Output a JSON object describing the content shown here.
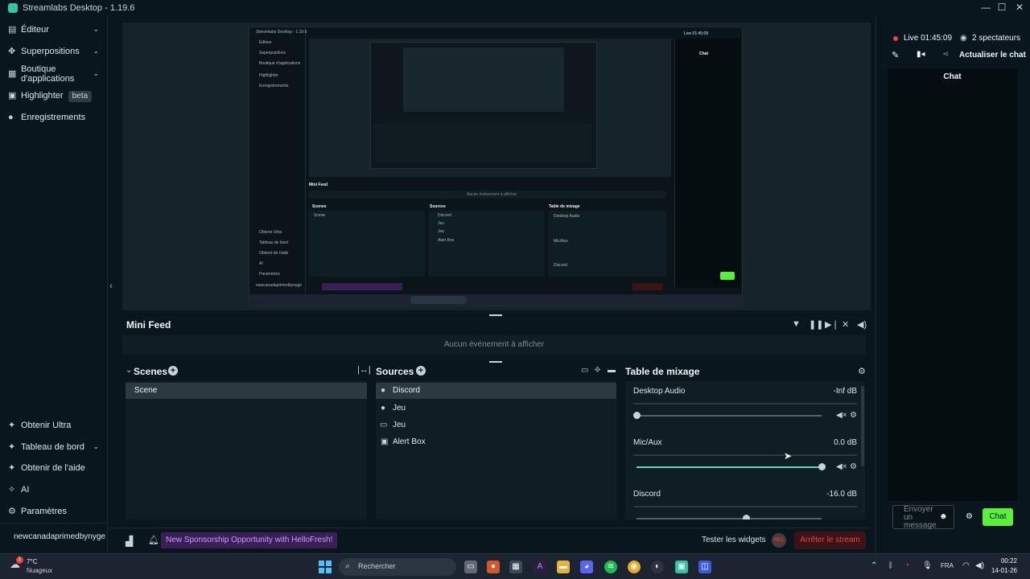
{
  "window": {
    "title": "Streamlabs Desktop - 1.19.6"
  },
  "sidebar": {
    "items": [
      {
        "label": "Éditeur",
        "icon": "editor-icon",
        "chevron": true
      },
      {
        "label": "Superpositions",
        "icon": "overlay-icon",
        "chevron": true
      },
      {
        "label": "Boutique d'applications",
        "icon": "store-icon",
        "chevron": true
      },
      {
        "label": "Highlighter",
        "icon": "highlighter-icon",
        "badge": "beta"
      },
      {
        "label": "Enregistrements",
        "icon": "record-icon"
      }
    ],
    "bottom_items": [
      {
        "label": "Obtenir Ultra",
        "icon": "ultra-icon"
      },
      {
        "label": "Tableau de bord",
        "icon": "dashboard-icon",
        "chevron": true
      },
      {
        "label": "Obtenir de l'aide",
        "icon": "help-icon"
      },
      {
        "label": "AI",
        "icon": "ai-icon"
      },
      {
        "label": "Paramètres",
        "icon": "settings-icon"
      }
    ],
    "username": "newcanadaprimedbynyge"
  },
  "minifeed": {
    "title": "Mini Feed",
    "empty": "Aucun événement à afficher"
  },
  "scenes": {
    "title": "Scenes",
    "items": [
      "Scene"
    ]
  },
  "sources": {
    "title": "Sources",
    "items": [
      {
        "label": "Discord",
        "icon": "user-icon"
      },
      {
        "label": "Jeu",
        "icon": "user-icon"
      },
      {
        "label": "Jeu",
        "icon": "monitor-icon"
      },
      {
        "label": "Alert Box",
        "icon": "alert-icon"
      }
    ]
  },
  "mixer": {
    "title": "Table de mixage",
    "channels": [
      {
        "name": "Desktop Audio",
        "db": "-Inf dB",
        "level": 0.0
      },
      {
        "name": "Mic/Aux",
        "db": "0.0 dB",
        "level": 1.0
      },
      {
        "name": "Discord",
        "db": "-16.0 dB",
        "level": 0.6
      }
    ]
  },
  "bottombar": {
    "notification": "New Sponsorship Opportunity with HelloFresh!",
    "test_widgets": "Tester les widgets",
    "rec": "REC",
    "stop_stream": "Arrêter le stream"
  },
  "rightpanel": {
    "live": "Live 01:45:09",
    "viewers": "2 spectateurs",
    "refresh_chat": "Actualiser le chat",
    "chat_title": "Chat",
    "chat_placeholder": "Envoyer un message",
    "chat_button": "Chat"
  },
  "taskbar": {
    "weather_temp": "7°C",
    "weather_desc": "Nuageux",
    "search": "Rechercher",
    "lang": "FRA",
    "time": "00:22",
    "date": "14-01-26",
    "notif_count": "1"
  },
  "colors": {
    "accent": "#31c3a2",
    "live": "#e9463f",
    "chat_button": "#5aef3c",
    "stop": "#e9463f"
  }
}
